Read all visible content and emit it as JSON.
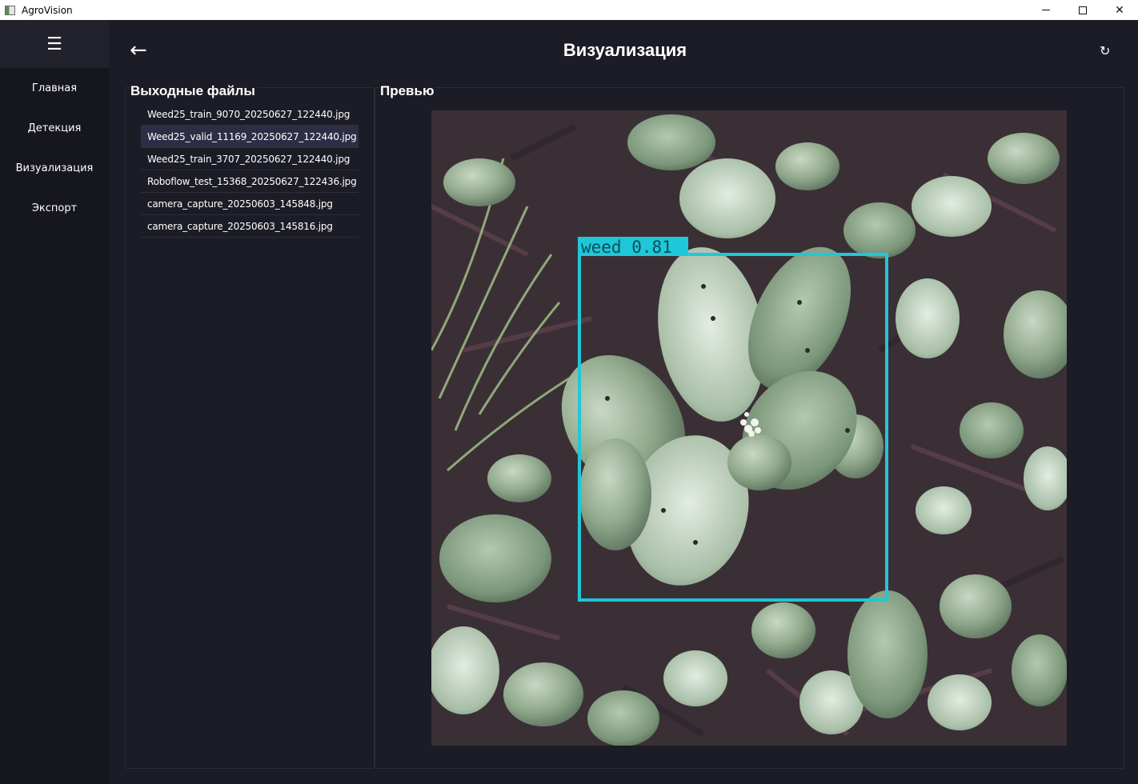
{
  "window": {
    "title": "AgroVision",
    "controls": {
      "minimize": "—",
      "close": "✕"
    }
  },
  "sidebar": {
    "menu_icon": "☰",
    "items": [
      {
        "label": "Главная"
      },
      {
        "label": "Детекция"
      },
      {
        "label": "Визуализация"
      },
      {
        "label": "Экспорт"
      }
    ]
  },
  "header": {
    "back_icon": "←",
    "title": "Визуализация",
    "refresh_icon": "↻"
  },
  "files": {
    "group_label": "Выходные файлы",
    "selected_index": 1,
    "items": [
      "Weed25_train_9070_20250627_122440.jpg",
      "Weed25_valid_11169_20250627_122440.jpg",
      "Weed25_train_3707_20250627_122440.jpg",
      "Roboflow_test_15368_20250627_122436.jpg",
      "camera_capture_20250603_145848.jpg",
      "camera_capture_20250603_145816.jpg"
    ]
  },
  "preview": {
    "group_label": "Превью",
    "detection": {
      "label": "weed",
      "confidence": "0.81",
      "color": "#1ec8d8"
    }
  },
  "colors": {
    "background": "#1b1c25",
    "sidebar": "#16171e",
    "selected_row": "#2d2e45",
    "box": "#1ec8d8"
  }
}
